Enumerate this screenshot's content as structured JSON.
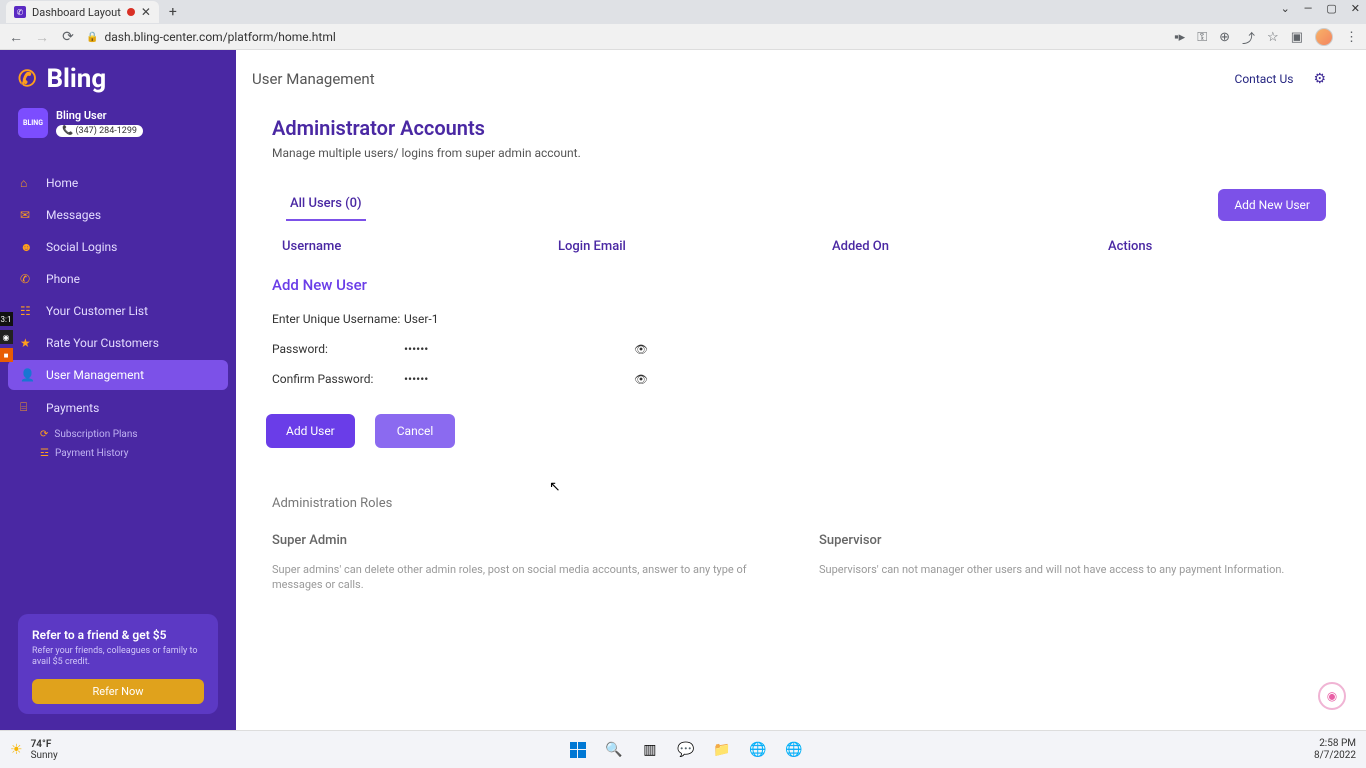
{
  "browser": {
    "tab_title": "Dashboard Layout",
    "url": "dash.bling-center.com/platform/home.html"
  },
  "brand": {
    "name": "Bling"
  },
  "user": {
    "name": "Bling User",
    "phone": "(347) 284-1299",
    "badge": "BLING"
  },
  "sidebar": {
    "items": [
      {
        "label": "Home",
        "icon": "⌂"
      },
      {
        "label": "Messages",
        "icon": "✉"
      },
      {
        "label": "Social Logins",
        "icon": "☻"
      },
      {
        "label": "Phone",
        "icon": "✆"
      },
      {
        "label": "Your Customer List",
        "icon": "☷"
      },
      {
        "label": "Rate Your Customers",
        "icon": "★"
      },
      {
        "label": "User Management",
        "icon": "👤"
      },
      {
        "label": "Payments",
        "icon": "⌸"
      }
    ],
    "subs": [
      {
        "label": "Subscription Plans"
      },
      {
        "label": "Payment History"
      }
    ]
  },
  "refer": {
    "title": "Refer to a friend & get $5",
    "desc": "Refer your friends, colleagues or family to avail $5 credit.",
    "button": "Refer Now"
  },
  "header": {
    "page_title": "User Management",
    "contact": "Contact Us"
  },
  "admin": {
    "title": "Administrator Accounts",
    "subtitle": "Manage multiple users/ logins from super admin account.",
    "tab_all_users": "All Users (0)",
    "add_new_user_btn": "Add New User",
    "columns": {
      "username": "Username",
      "email": "Login Email",
      "added": "Added On",
      "actions": "Actions"
    }
  },
  "form": {
    "title": "Add New User",
    "labels": {
      "username": "Enter Unique Username:",
      "password": "Password:",
      "confirm": "Confirm Password:"
    },
    "values": {
      "username": "User-1",
      "password": "••••••",
      "confirm": "••••••"
    },
    "buttons": {
      "add": "Add User",
      "cancel": "Cancel"
    }
  },
  "roles": {
    "title": "Administration Roles",
    "items": [
      {
        "name": "Super Admin",
        "desc": "Super admins' can delete other admin roles, post on social media accounts, answer to any type of messages or calls."
      },
      {
        "name": "Supervisor",
        "desc": "Supervisors' can not manager other users and will not have access to any payment Information."
      }
    ]
  },
  "taskbar": {
    "temp": "74°F",
    "weather": "Sunny",
    "time": "2:58 PM",
    "date": "8/7/2022"
  }
}
